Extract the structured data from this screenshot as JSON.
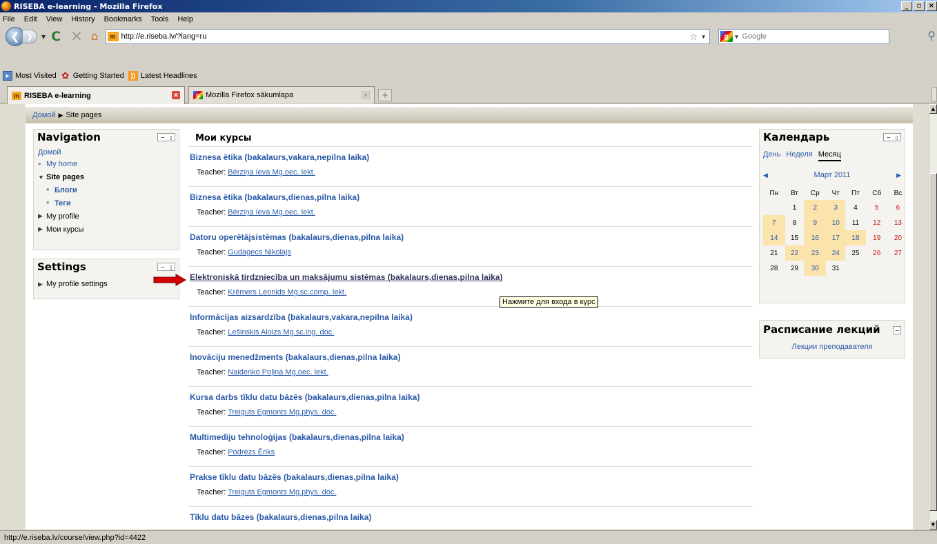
{
  "window": {
    "title": "RISEBA e-learning - Mozilla Firefox"
  },
  "menu": [
    "File",
    "Edit",
    "View",
    "History",
    "Bookmarks",
    "Tools",
    "Help"
  ],
  "urlbar": {
    "url": "http://e.riseba.lv/?lang=ru",
    "site_icon": "m"
  },
  "search": {
    "placeholder": "Google"
  },
  "bookmarks": [
    "Most Visited",
    "Getting Started",
    "Latest Headlines"
  ],
  "tabs": [
    {
      "label": "RISEBA e-learning"
    },
    {
      "label": "Mozilla Firefox sākumlapa"
    }
  ],
  "breadcrumb": {
    "home": "Домой",
    "current": "Site pages"
  },
  "navigation": {
    "title": "Navigation",
    "home": "Домой",
    "my_home": "My home",
    "site_pages": "Site pages",
    "blogs": "Блоги",
    "tags": "Теги",
    "my_profile": "My profile",
    "my_courses": "Мои курсы"
  },
  "settings": {
    "title": "Settings",
    "profile_settings": "My profile settings"
  },
  "main": {
    "title": "Мои курсы",
    "teacher_label": "Teacher:",
    "courses": [
      {
        "name": "Biznesa ētika (bakalaurs,vakara,nepilna laika)",
        "teacher": "Bērziņa Ieva Mg.oec. lekt."
      },
      {
        "name": "Biznesa ētika (bakalaurs,dienas,pilna laika)",
        "teacher": "Bērziņa Ieva Mg.oec. lekt."
      },
      {
        "name": "Datoru operētājsistēmas (bakalaurs,dienas,pilna laika)",
        "teacher": "Gudagecs Nikolajs"
      },
      {
        "name": "Elektroniskā tirdzniecība un maksājumu sistēmas (bakalaurs,dienas,pilna laika)",
        "teacher": "Krēmers Leonids Mg.sc.comp. lekt."
      },
      {
        "name": "Informācijas aizsardzība (bakalaurs,vakara,nepilna laika)",
        "teacher": "Lešinskis Aloizs Mg.sc.ing. doc."
      },
      {
        "name": "Inovāciju menedžments (bakalaurs,dienas,pilna laika)",
        "teacher": "Naidenko Poļina Mg.oec. lekt."
      },
      {
        "name": "Kursa darbs tīklu datu bāzēs (bakalaurs,dienas,pilna laika)",
        "teacher": "Treiguts Egmonts Mg.phys. doc."
      },
      {
        "name": "Multimediju tehnoloģijas (bakalaurs,dienas,pilna laika)",
        "teacher": "Podrezs Ēriks"
      },
      {
        "name": "Prakse tīklu datu bāzēs (bakalaurs,dienas,pilna laika)",
        "teacher": "Treiguts Egmonts Mg.phys. doc."
      },
      {
        "name": "Tīklu datu bāzes (bakalaurs,dienas,pilna laika)",
        "teacher": ""
      }
    ],
    "tooltip": "Нажмите для входа в курс"
  },
  "calendar": {
    "title": "Календарь",
    "tabs": [
      "День",
      "Неделя",
      "Месяц"
    ],
    "month": "Март 2011",
    "weekdays": [
      "Пн",
      "Вт",
      "Ср",
      "Чт",
      "Пт",
      "Сб",
      "Вс"
    ],
    "weeks": [
      [
        "",
        "1",
        "2",
        "3",
        "4",
        "5",
        "6"
      ],
      [
        "7",
        "8",
        "9",
        "10",
        "11",
        "12",
        "13"
      ],
      [
        "14",
        "15",
        "16",
        "17",
        "18",
        "19",
        "20"
      ],
      [
        "21",
        "22",
        "23",
        "24",
        "25",
        "26",
        "27"
      ],
      [
        "28",
        "29",
        "30",
        "31",
        "",
        "",
        ""
      ]
    ],
    "event_days": [
      "2",
      "3",
      "7",
      "9",
      "10",
      "14",
      "16",
      "17",
      "18",
      "22",
      "23",
      "24",
      "30"
    ],
    "weekend_days": [
      "5",
      "6",
      "12",
      "13",
      "19",
      "20",
      "26",
      "27"
    ]
  },
  "schedule": {
    "title": "Расписание лекций",
    "link": "Лекции преподавателя"
  },
  "status": {
    "text": "http://e.riseba.lv/course/view.php?id=4422"
  },
  "colors": {
    "link": "#2a5aa8",
    "event_bg": "#fbe3ac",
    "weekend": "#c81818",
    "arrow": "#d40000"
  }
}
